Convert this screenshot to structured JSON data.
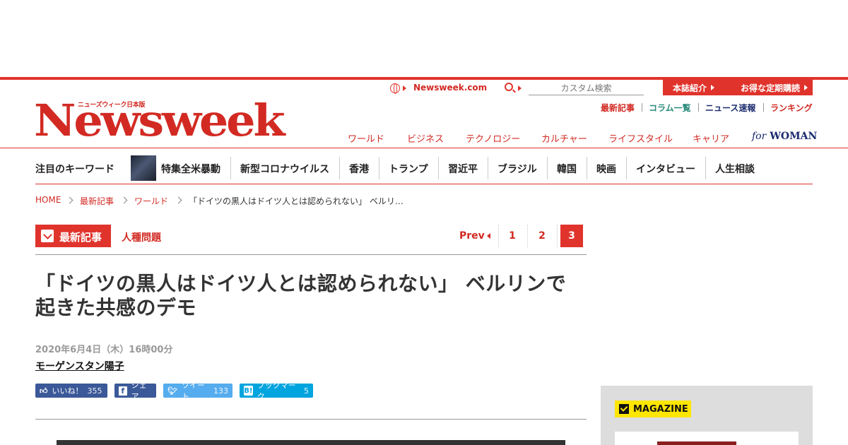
{
  "header": {
    "site_link": "Newsweek.com",
    "search_placeholder": "カスタム検索",
    "tab_about": "本誌紹介",
    "tab_subscribe": "お得な定期購読",
    "util_links": [
      "最新記事",
      "コラム一覧",
      "ニュース速報",
      "ランキング"
    ],
    "logo_small": "ニューズウィーク日本版",
    "logo": "Newsweek",
    "nav": [
      "ワールド",
      "ビジネス",
      "テクノロジー",
      "カルチャー",
      "ライフスタイル",
      "キャリア"
    ],
    "for_woman_for": "for",
    "for_woman_text": "WOMAN"
  },
  "keywords": {
    "label": "注目のキーワード",
    "items": [
      "特集全米暴動",
      "新型コロナウイルス",
      "香港",
      "トランプ",
      "習近平",
      "ブラジル",
      "韓国",
      "映画",
      "インタビュー",
      "人生相談"
    ]
  },
  "breadcrumb": [
    "HOME",
    "最新記事",
    "ワールド",
    "「ドイツの黒人はドイツ人とは認められない」 ベルリ…"
  ],
  "category": {
    "label": "最新記事",
    "tag": "人種問題"
  },
  "pagination": {
    "prev": "Prev",
    "pages": [
      "1",
      "2",
      "3"
    ],
    "current": "3"
  },
  "article": {
    "title_line1": "「ドイツの黒人はドイツ人とは認められない」 ベルリンで",
    "title_line2": "起きた共感のデモ",
    "date": "2020年6月4日（木）16時00分",
    "author": "モーゲンスタン陽子"
  },
  "share": {
    "like_label": "いいね！",
    "like_count": "355",
    "fb_label": "シェア",
    "tweet_label": "ツイート",
    "tweet_count": "133",
    "hatena_label": "ブックマーク",
    "hatena_count": "5"
  },
  "sidebar": {
    "magazine_label": "MAGAZINE"
  },
  "colors": {
    "brand_red": "#e0332c",
    "facebook": "#3b5998",
    "twitter": "#55acee",
    "hatena": "#00a4de",
    "magazine_yellow": "#ffe600"
  }
}
